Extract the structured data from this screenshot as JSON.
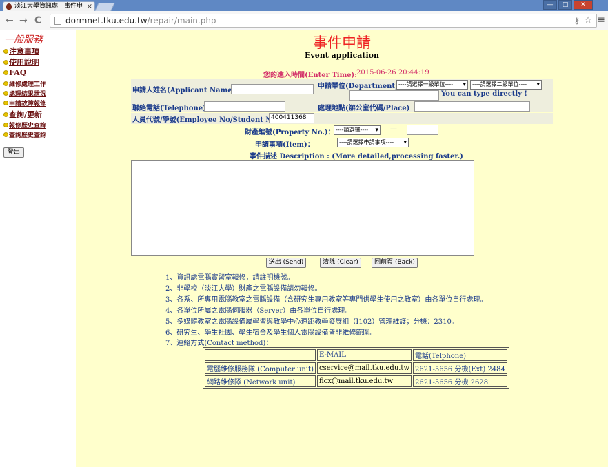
{
  "browser": {
    "tab_title": "淡江大學資訊處　事件申",
    "tab_close": "×",
    "url_host": "dormnet.tku.edu.tw",
    "url_path": "/repair/main.php",
    "back": "←",
    "forward": "→",
    "reload": "C",
    "menu": "≡",
    "window_buttons": [
      "—",
      "□",
      "✕"
    ]
  },
  "sidebar": {
    "heading": "一般服務",
    "items": [
      {
        "label": "注意事項"
      },
      {
        "label": "使用說明"
      },
      {
        "label": "FAQ"
      },
      {
        "label": "維修處理工作"
      },
      {
        "label": "處理結果狀況"
      },
      {
        "label": "申請故障報修"
      },
      {
        "label": "查詢/更新"
      },
      {
        "label": "報修歷史查詢"
      },
      {
        "label": "查詢歷史查詢"
      }
    ],
    "logout": "登出"
  },
  "page": {
    "title": "事件申請",
    "subtitle": "Event application",
    "enter_time_label": "您的進入時間(Enter Time):",
    "enter_time_value": "2015-06-26 20:44:19",
    "applicant_label": "申請人姓名(Applicant Name):",
    "department_label": "申請單位(Department):",
    "dept_select1": "----請選擇一級單位----",
    "dept_select2": "----請選擇二級單位----",
    "type_directly": "You can type directly !",
    "telephone_label": "聯絡電話(Telephone):",
    "place_label": "處理地點(辦公室代碼/Place)",
    "employee_label": "人員代號/學號(Employee No/Student No):",
    "employee_value": "400411368",
    "property_label": "財產編號(Property No.)：",
    "property_select": "----請選擇----",
    "property_dash": "—",
    "item_label": "申請事項(Item)：",
    "item_select": "----請選擇申請事項----",
    "description_label": "事件描述 Description : (More detailed,processing faster.)",
    "send_button": "送出 (Send)",
    "clear_button": "清除 (Clear)",
    "back_button": "回前頁 (Back)"
  },
  "notes": [
    "1、資訊處電腦實習室報修，請註明機號。",
    "2、非學校（淡江大學）財產之電腦設備請勿報修。",
    "3、各系、所專用電腦教室之電腦設備（含研究生專用教室等專門供學生使用之教室）由各單位自行處理。",
    "4、各單位所屬之電腦伺服器（Server）由各單位自行處理。",
    "5、多媒體教室之電腦設備屬學習與教學中心遠距教學發展組（I102）管理維護；分機：2310。",
    "6、研究生、學生社團、學生宿舍及學生個人電腦設備皆非維修範圍。",
    "7、連絡方式(Contact method)："
  ],
  "contact_table": {
    "headers": [
      "",
      "E-MAIL",
      "電話(Telphone)"
    ],
    "rows": [
      [
        "電腦維修服務隊 (Computer unit)",
        "cservice@mail.tku.edu.tw",
        "2621-5656 分機(Ext) 2484"
      ],
      [
        "網路維修隊 (Network unit)",
        "ficx@mail.tku.edu.tw",
        "2621-5656 分機 2628"
      ]
    ]
  }
}
